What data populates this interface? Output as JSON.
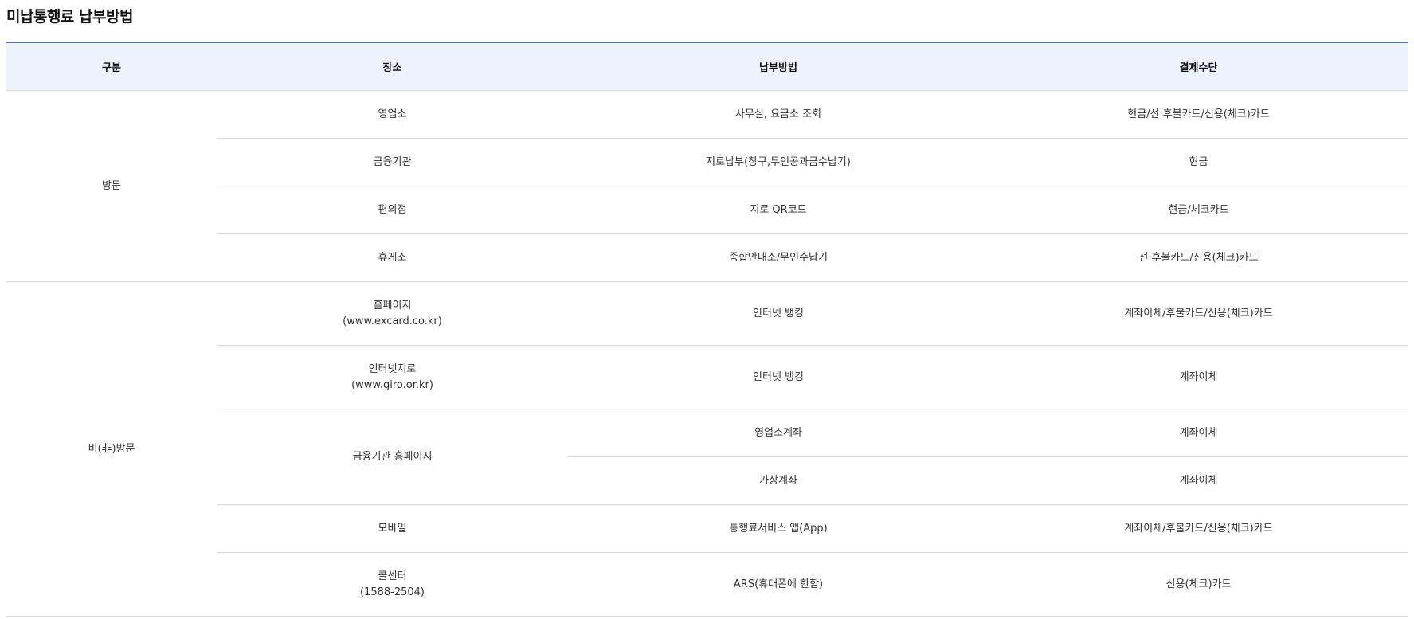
{
  "page": {
    "title": "미납통행료 납부방법"
  },
  "table": {
    "headers": [
      "구분",
      "장소",
      "납부방법",
      "결제수단"
    ],
    "groups": {
      "visit": "방문",
      "nonvisit": "비(非)방문"
    },
    "rows": [
      {
        "place": "영업소",
        "method": "사무실, 요금소 조회",
        "payment": "현금/선·후불카드/신용(체크)카드"
      },
      {
        "place": "금융기관",
        "method": "지로납부(창구,무인공과금수납기)",
        "payment": "현금"
      },
      {
        "place": "편의점",
        "method": "지로 QR코드",
        "payment": "현금/체크카드"
      },
      {
        "place": "휴게소",
        "method": "종합안내소/무인수납기",
        "payment": "선·후불카드/신용(체크)카드"
      },
      {
        "place": "홈페이지",
        "place_sub": "(www.excard.co.kr)",
        "method": "인터넷 뱅킹",
        "payment": "계좌이체/후불카드/신용(체크)카드"
      },
      {
        "place": "인터넷지로",
        "place_sub": "(www.giro.or.kr)",
        "method": "인터넷 뱅킹",
        "payment": "계좌이체"
      },
      {
        "place": "금융기관 홈페이지",
        "method": "영업소계좌",
        "payment": "계좌이체"
      },
      {
        "method": "가상계좌",
        "payment": "계좌이체"
      },
      {
        "place": "모바일",
        "method": "통행료서비스 앱(App)",
        "payment": "계좌이체/후불카드/신용(체크)카드"
      },
      {
        "place": "콜센터",
        "place_sub": "(1588-2504)",
        "method": "ARS(휴대폰에 한함)",
        "payment": "신용(체크)카드"
      }
    ]
  }
}
